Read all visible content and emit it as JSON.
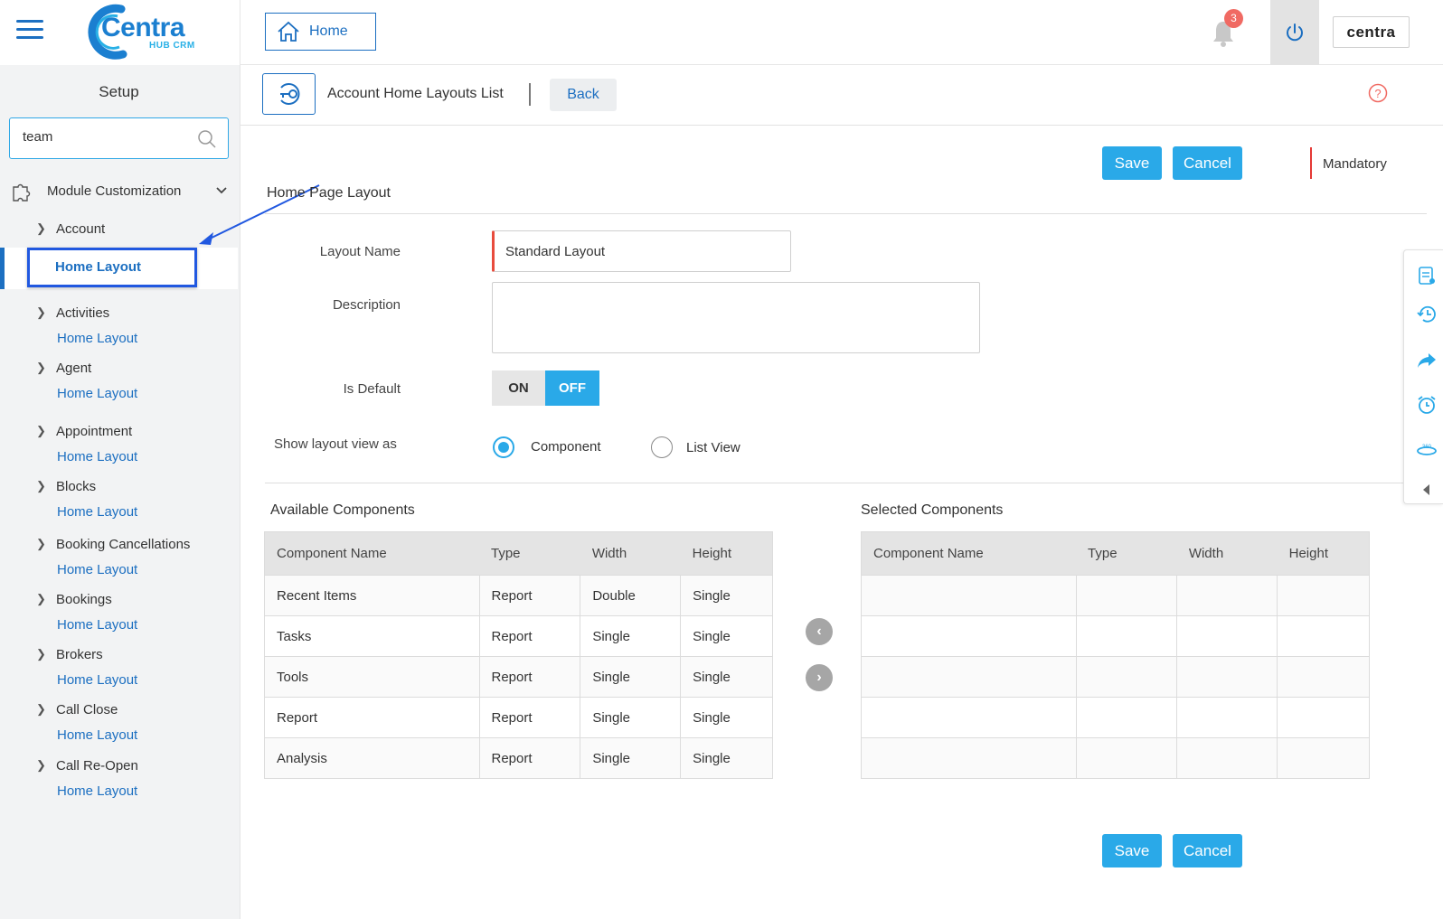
{
  "header": {
    "brand_name": "Centra",
    "brand_sub": "HUB CRM",
    "home_label": "Home",
    "notifications_count": "3",
    "account_brand": "centra"
  },
  "sidebar": {
    "title": "Setup",
    "search_value": "team",
    "module_label": "Module Customization",
    "active_item": "Home Layout",
    "tree": [
      {
        "parent": "Account",
        "child": "Home Layout"
      },
      {
        "parent": "Activities",
        "child": "Home Layout"
      },
      {
        "parent": "Agent",
        "child": "Home Layout"
      },
      {
        "parent": "Appointment",
        "child": "Home Layout"
      },
      {
        "parent": "Blocks",
        "child": "Home Layout"
      },
      {
        "parent": "Booking Cancellations",
        "child": "Home Layout"
      },
      {
        "parent": "Bookings",
        "child": "Home Layout"
      },
      {
        "parent": "Brokers",
        "child": "Home Layout"
      },
      {
        "parent": "Call Close",
        "child": "Home Layout"
      },
      {
        "parent": "Call Re-Open",
        "child": "Home Layout"
      }
    ]
  },
  "breadcrumb": {
    "title": "Account Home Layouts List",
    "back_label": "Back"
  },
  "actions": {
    "save_label": "Save",
    "cancel_label": "Cancel",
    "mandatory_label": "Mandatory"
  },
  "form": {
    "section_title": "Home Page Layout",
    "layout_name_label": "Layout Name",
    "layout_name_value": "Standard Layout",
    "description_label": "Description",
    "description_value": "",
    "is_default_label": "Is Default",
    "on_label": "ON",
    "off_label": "OFF",
    "is_default_selected": "OFF",
    "view_as_label": "Show layout view as",
    "view_options": [
      "Component",
      "List View"
    ],
    "view_selected": "Component"
  },
  "available": {
    "title": "Available Components",
    "columns": [
      "Component Name",
      "Type",
      "Width",
      "Height"
    ],
    "rows": [
      [
        "Recent Items",
        "Report",
        "Double",
        "Single"
      ],
      [
        "Tasks",
        "Report",
        "Single",
        "Single"
      ],
      [
        "Tools",
        "Report",
        "Single",
        "Single"
      ],
      [
        "Report",
        "Report",
        "Single",
        "Single"
      ],
      [
        "Analysis",
        "Report",
        "Single",
        "Single"
      ]
    ]
  },
  "selected": {
    "title": "Selected Components",
    "columns": [
      "Component Name",
      "Type",
      "Width",
      "Height"
    ],
    "rows": [
      [
        "",
        "",
        "",
        ""
      ],
      [
        "",
        "",
        "",
        ""
      ],
      [
        "",
        "",
        "",
        ""
      ],
      [
        "",
        "",
        "",
        ""
      ],
      [
        "",
        "",
        "",
        ""
      ]
    ]
  },
  "colors": {
    "primary": "#1c6fc1",
    "accent": "#2aa9e8",
    "mandatory": "#e53935",
    "badge": "#f06a63",
    "annotation": "#2158e0"
  }
}
